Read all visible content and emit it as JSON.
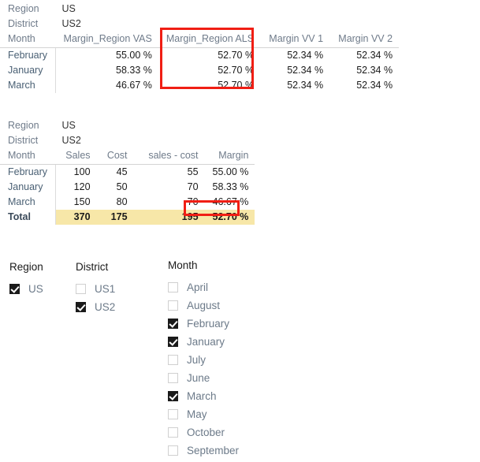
{
  "table_margin": {
    "axis_labels": [
      "Region",
      "District",
      "Month"
    ],
    "axis_values": [
      "US",
      "US2"
    ],
    "columns": [
      "Margin_Region VAS",
      "Margin_Region ALS",
      "Margin VV 1",
      "Margin VV 2"
    ],
    "rows": [
      {
        "month": "February",
        "values": [
          "55.00 %",
          "52.70 %",
          "52.34 %",
          "52.34 %"
        ]
      },
      {
        "month": "January",
        "values": [
          "58.33 %",
          "52.70 %",
          "52.34 %",
          "52.34 %"
        ]
      },
      {
        "month": "March",
        "values": [
          "46.67 %",
          "52.70 %",
          "52.34 %",
          "52.34 %"
        ]
      }
    ],
    "highlight_column": "Margin_Region ALS",
    "highlight_color": "#f01e14"
  },
  "table_detail": {
    "axis_labels": [
      "Region",
      "District",
      "Month"
    ],
    "axis_values": [
      "US",
      "US2"
    ],
    "columns": [
      "Sales",
      "Cost",
      "sales - cost",
      "Margin"
    ],
    "rows": [
      {
        "month": "February",
        "values": [
          "100",
          "45",
          "55",
          "55.00 %"
        ]
      },
      {
        "month": "January",
        "values": [
          "120",
          "50",
          "70",
          "58.33 %"
        ]
      },
      {
        "month": "March",
        "values": [
          "150",
          "80",
          "70",
          "46.67 %"
        ]
      }
    ],
    "total": {
      "label": "Total",
      "values": [
        "370",
        "175",
        "195",
        "52.70 %"
      ]
    },
    "total_fill_color": "#f7e7a8",
    "highlight_cell": "52.70 %",
    "highlight_color": "#f01e14"
  },
  "slicers": [
    {
      "title": "Region",
      "items": [
        {
          "label": "US",
          "checked": true
        }
      ]
    },
    {
      "title": "District",
      "items": [
        {
          "label": "US1",
          "checked": false
        },
        {
          "label": "US2",
          "checked": true
        }
      ]
    },
    {
      "title": "Month",
      "items": [
        {
          "label": "April",
          "checked": false
        },
        {
          "label": "August",
          "checked": false
        },
        {
          "label": "February",
          "checked": true
        },
        {
          "label": "January",
          "checked": true
        },
        {
          "label": "July",
          "checked": false
        },
        {
          "label": "June",
          "checked": false
        },
        {
          "label": "March",
          "checked": true
        },
        {
          "label": "May",
          "checked": false
        },
        {
          "label": "October",
          "checked": false
        },
        {
          "label": "September",
          "checked": false
        }
      ]
    }
  ]
}
